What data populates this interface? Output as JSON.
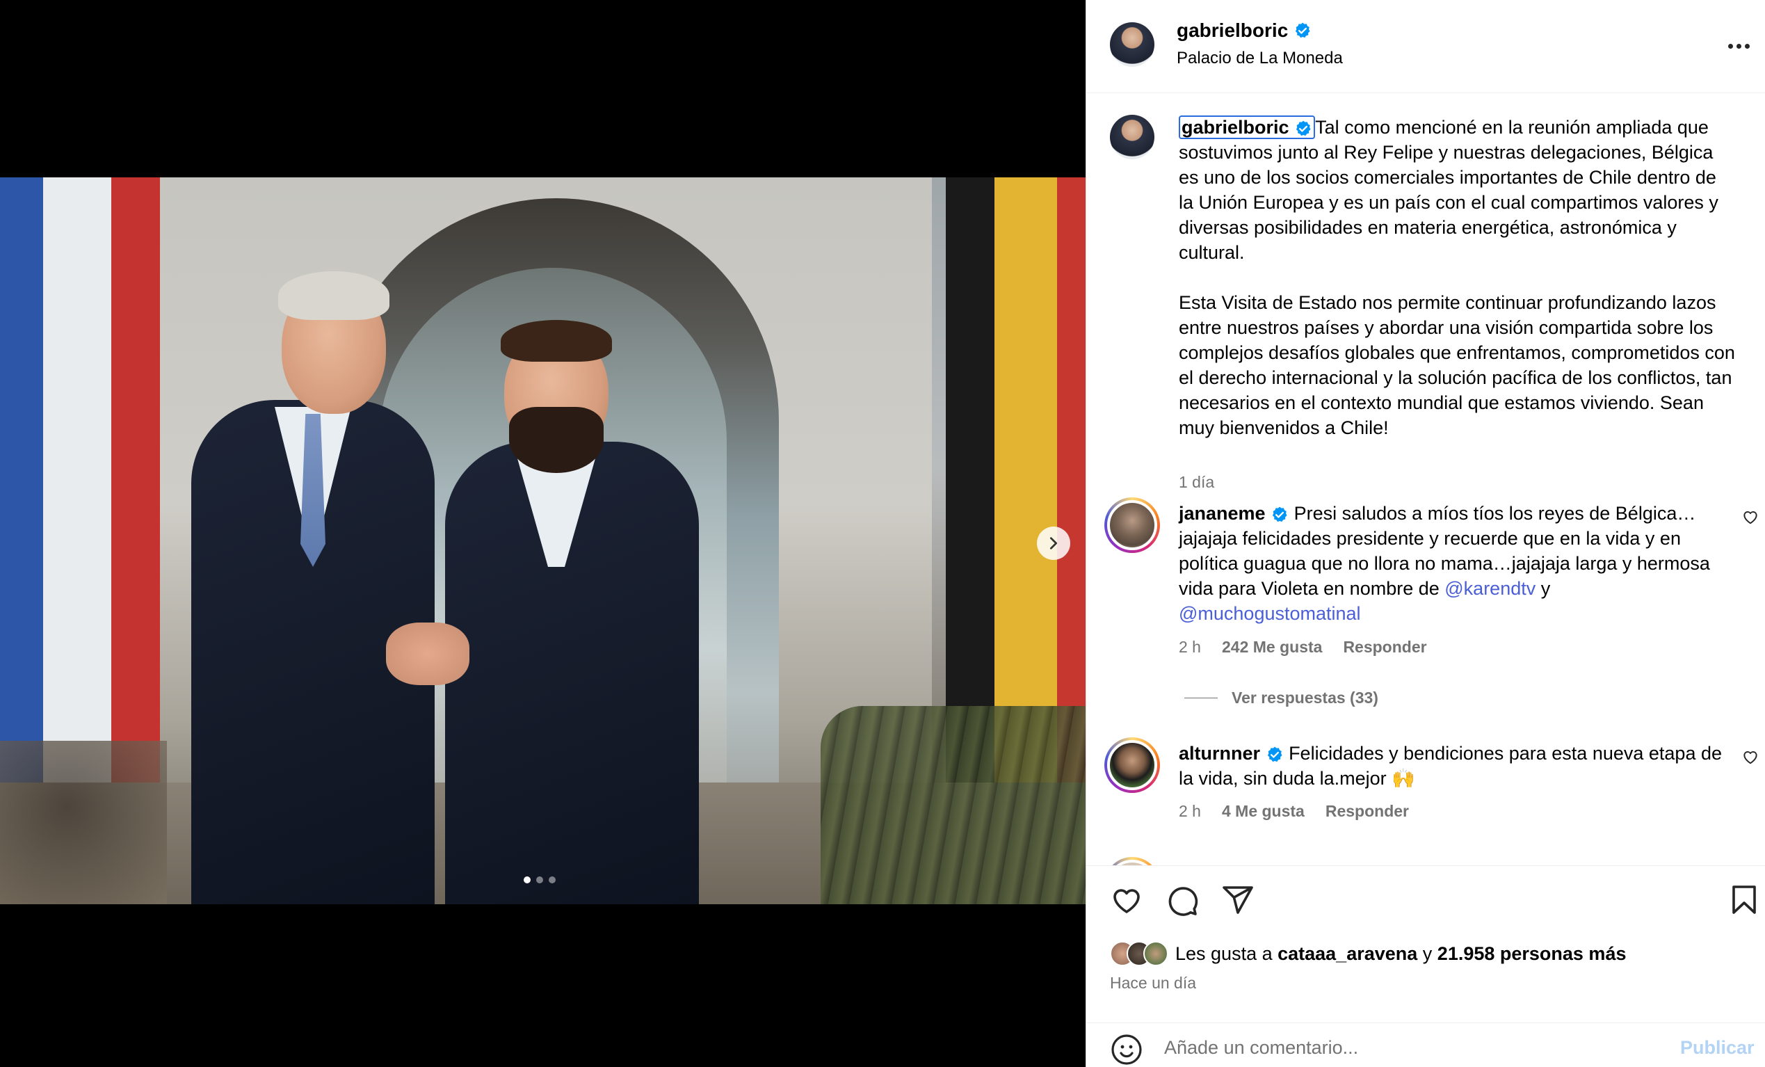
{
  "post": {
    "username": "gabrielboric",
    "verified": true,
    "location": "Palacio de La Moneda",
    "caption": "Tal como mencioné en la reunión ampliada que sostuvimos junto al Rey Felipe y nuestras delegaciones, Bélgica es uno de los socios comerciales importantes de Chile dentro de la Unión Europea y es un país con el cual compartimos valores y diversas posibilidades en materia energética, astronómica y cultural.\n\nEsta Visita de Estado nos permite continuar profundizando lazos entre nuestros países y abordar una visión compartida sobre los complejos desafíos globales que enfrentamos, comprometidos con el derecho internacional y la solución pacífica de los conflictos, tan necesarios en el contexto mundial que estamos viviendo. Sean muy bienvenidos a Chile!",
    "caption_time": "1 día"
  },
  "carousel": {
    "dot_count": 3,
    "active_index": 0
  },
  "comments": [
    {
      "username": "jananeme",
      "verified": true,
      "text_before": "Presi saludos a míos tíos los reyes de Bélgica… jajajaja felicidades presidente y recuerde que en la vida y en política guagua que no llora no mama…jajajaja larga y hermosa vida para Violeta en nombre de ",
      "mention_1": "@karendtv",
      "text_mid": " y ",
      "mention_2": "@muchogustomatinal",
      "time": "2 h",
      "likes": "242 Me gusta",
      "reply": "Responder",
      "view_replies": "Ver respuestas (33)"
    },
    {
      "username": "alturnner",
      "verified": true,
      "text": "Felicidades y bendiciones para esta nueva etapa de la vida, sin duda la.mejor 🙌",
      "time": "2 h",
      "likes": "4 Me gusta",
      "reply": "Responder"
    }
  ],
  "likes_summary": {
    "prefix": "Les gusta a ",
    "user": "cataaa_aravena",
    "middle": " y ",
    "others": "21.958 personas más"
  },
  "time_ago": "Hace un día",
  "add_comment": {
    "placeholder": "Añade un comentario...",
    "publish_label": "Publicar"
  },
  "icons": {
    "verified": "verified-badge-icon",
    "like": "heart-icon",
    "comment": "comment-bubble-icon",
    "share": "paper-plane-icon",
    "save": "bookmark-icon",
    "emoji": "smiley-icon",
    "more": "more-horizontal-icon",
    "next": "chevron-right-icon"
  },
  "colors": {
    "verified_blue": "#0095f6",
    "mention_blue": "#4a5fd6",
    "muted_text": "#737373",
    "publish_disabled": "#b3d3f5"
  }
}
